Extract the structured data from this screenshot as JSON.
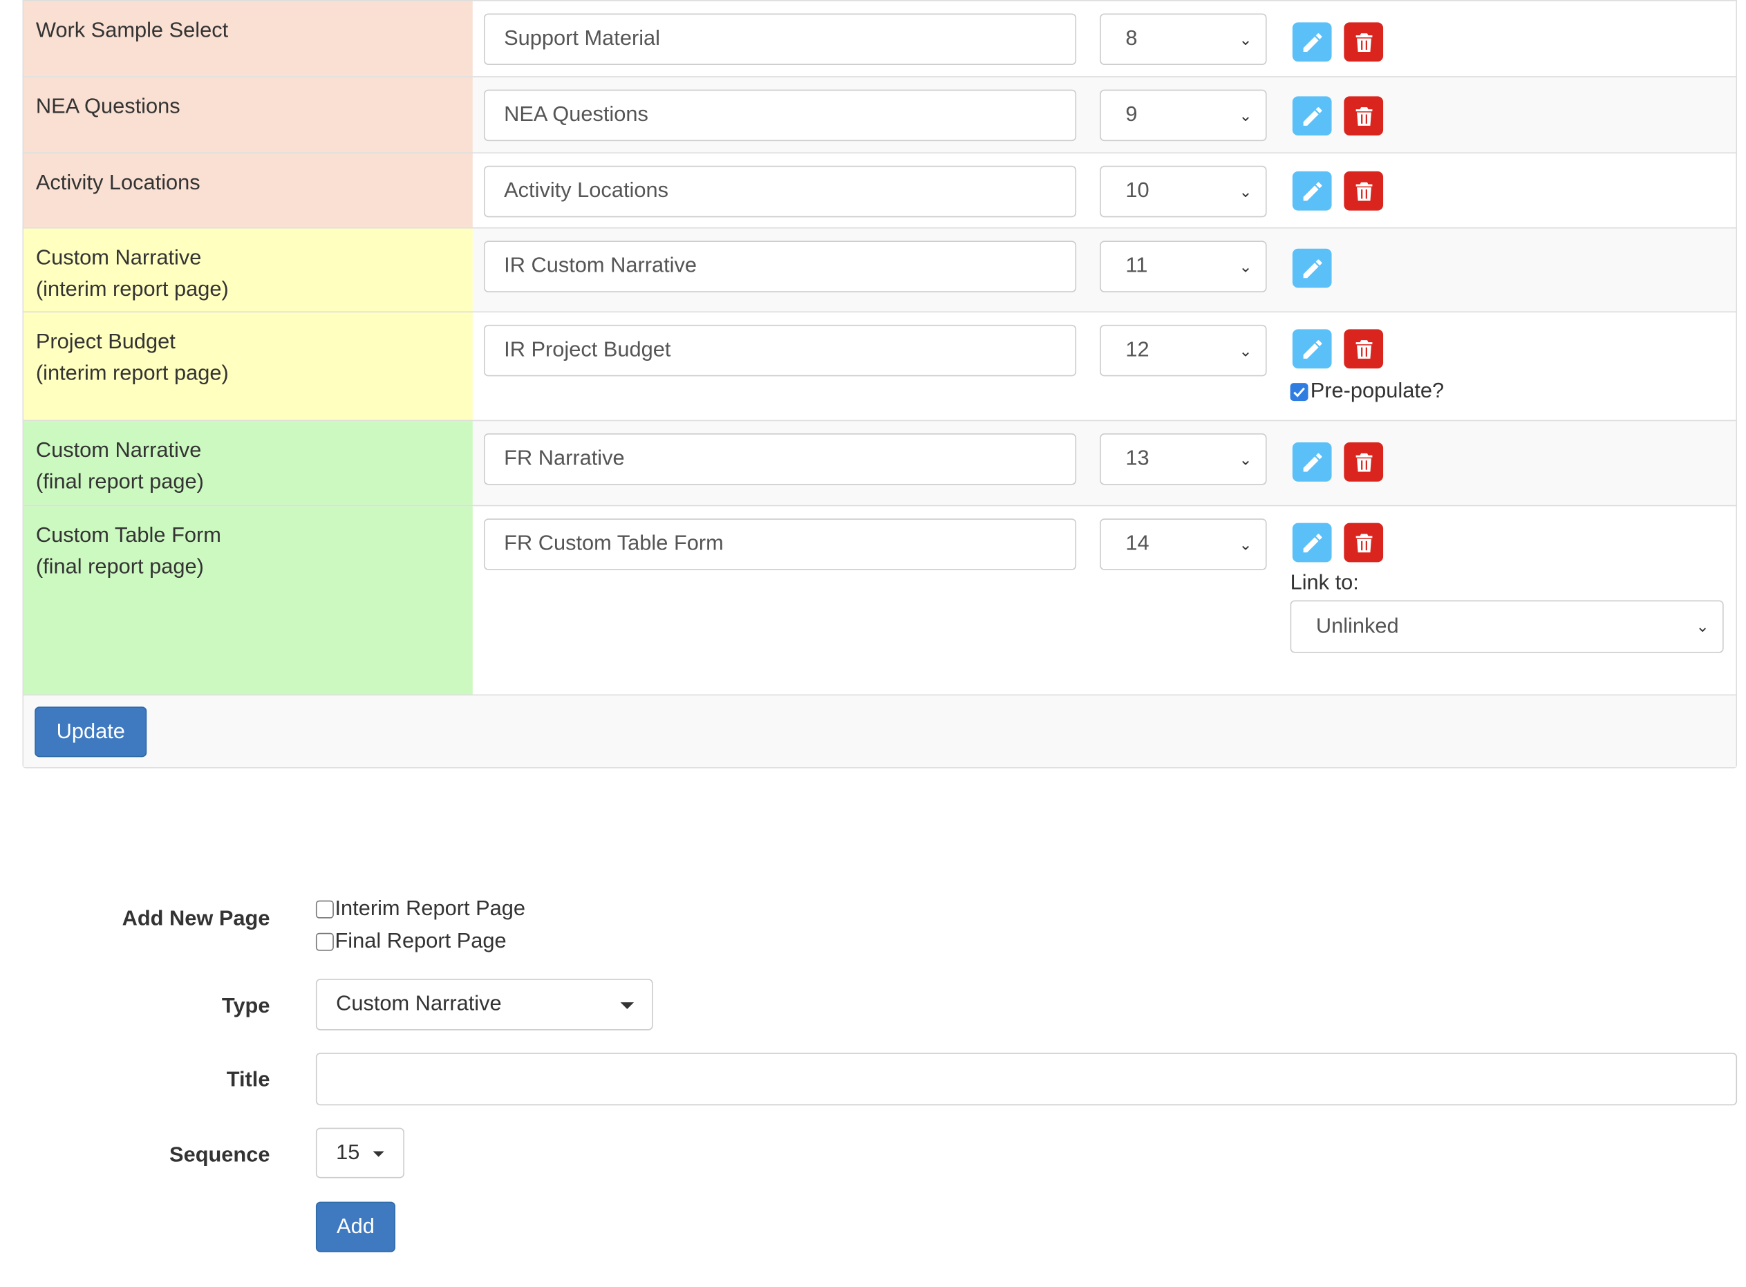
{
  "rows": [
    {
      "label_lines": [
        "Work Sample Select"
      ],
      "title": "Support Material",
      "sequence": "8",
      "has_delete": true
    },
    {
      "label_lines": [
        "NEA Questions"
      ],
      "title": "NEA Questions",
      "sequence": "9",
      "has_delete": true
    },
    {
      "label_lines": [
        "Activity Locations"
      ],
      "title": "Activity Locations",
      "sequence": "10",
      "has_delete": true
    },
    {
      "label_lines": [
        "Custom Narrative",
        "(interim report page)"
      ],
      "title": "IR Custom Narrative",
      "sequence": "11",
      "has_delete": false
    },
    {
      "label_lines": [
        "Project Budget",
        "(interim report page)"
      ],
      "title": "IR Project Budget",
      "sequence": "12",
      "has_delete": true,
      "prepopulate_label": "Pre-populate?",
      "prepopulate_checked": true
    },
    {
      "label_lines": [
        "Custom Narrative",
        "(final report page)"
      ],
      "title": "FR Narrative",
      "sequence": "13",
      "has_delete": true
    },
    {
      "label_lines": [
        "Custom Table Form",
        "(final report page)"
      ],
      "title": "FR Custom Table Form",
      "sequence": "14",
      "has_delete": true,
      "link_to_label": "Link to:",
      "link_to_value": "Unlinked"
    }
  ],
  "update_label": "Update",
  "add_form": {
    "add_new_page_label": "Add New Page",
    "options": [
      "Interim Report Page",
      "Final Report Page"
    ],
    "type_label": "Type",
    "type_value": "Custom Narrative",
    "title_label": "Title",
    "title_value": "",
    "sequence_label": "Sequence",
    "sequence_value": "15",
    "add_label": "Add"
  },
  "colors": {
    "orange_row": "#f9e0d3",
    "yellow_row": "#ffffc0",
    "green_row": "#ccf9c0",
    "edit_button": "#5bc0f8",
    "delete_button": "#d9251d",
    "primary_button": "#3f7ac1"
  },
  "icons": {
    "edit": "pencil-icon",
    "delete": "trash-icon",
    "dropdown": "chevron-down-icon"
  }
}
